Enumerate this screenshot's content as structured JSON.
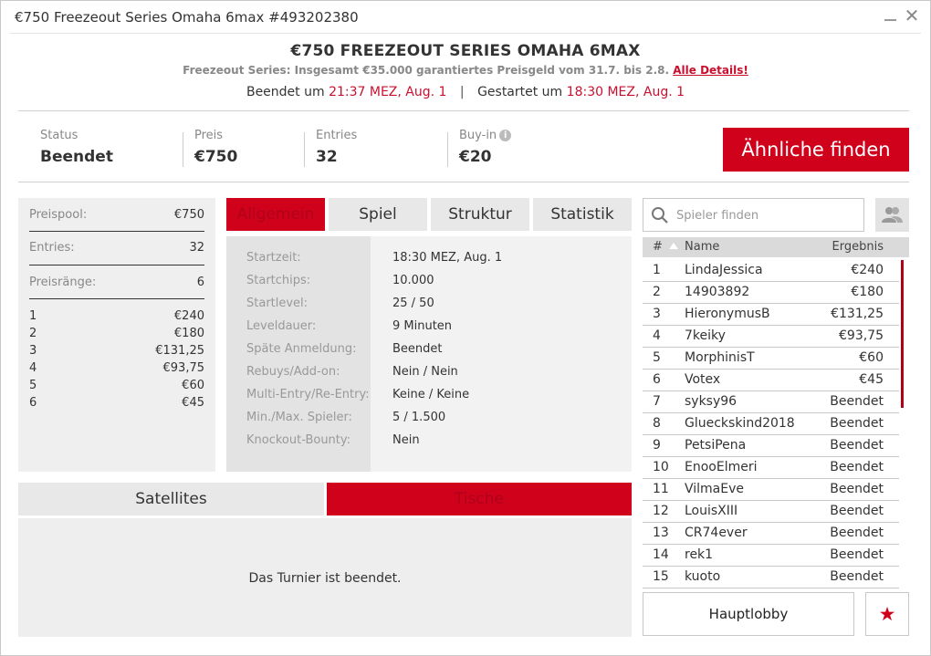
{
  "window": {
    "title": "€750 Freezeout Series Omaha 6max #493202380",
    "minimize_icon": "minimize-icon",
    "close_icon": "close-icon",
    "close_glyph": "✕"
  },
  "header": {
    "title": "€750 FREEZEOUT SERIES OMAHA 6MAX",
    "subtitle": "Freezeout Series: Insgesamt €35.000 garantiertes Preisgeld vom 31.7. bis 2.8.",
    "details_link": "Alle Details!",
    "ended_label": "Beendet um",
    "ended_time": "21:37 MEZ, Aug. 1",
    "separator": "|",
    "started_label": "Gestartet um",
    "started_time": "18:30 MEZ, Aug. 1"
  },
  "stats": [
    {
      "label": "Status",
      "value": "Beendet"
    },
    {
      "label": "Preis",
      "value": "€750"
    },
    {
      "label": "Entries",
      "value": "32"
    },
    {
      "label": "Buy-in",
      "value": "€20"
    }
  ],
  "buyin_info_icon": "info-icon",
  "buyin_info_glyph": "i",
  "similar_button": "Ähnliche finden",
  "prize_panel": {
    "prizepool_label": "Preispool:",
    "prizepool_value": "€750",
    "entries_label": "Entries:",
    "entries_value": "32",
    "ranks_label": "Preisränge:",
    "ranks_value": "6",
    "payouts": [
      {
        "rank": "1",
        "amount": "€240"
      },
      {
        "rank": "2",
        "amount": "€180"
      },
      {
        "rank": "3",
        "amount": "€131,25"
      },
      {
        "rank": "4",
        "amount": "€93,75"
      },
      {
        "rank": "5",
        "amount": "€60"
      },
      {
        "rank": "6",
        "amount": "€45"
      }
    ]
  },
  "tabs": [
    "Allgemein",
    "Spiel",
    "Struktur",
    "Statistik"
  ],
  "active_tab": "Allgemein",
  "info": [
    {
      "key": "Startzeit:",
      "value": "18:30 MEZ, Aug. 1"
    },
    {
      "key": "Startchips:",
      "value": "10.000"
    },
    {
      "key": "Startlevel:",
      "value": "25 / 50"
    },
    {
      "key": "Leveldauer:",
      "value": "9 Minuten"
    },
    {
      "key": "Späte Anmeldung:",
      "value": "Beendet"
    },
    {
      "key": "Rebuys/Add-on:",
      "value": "Nein / Nein"
    },
    {
      "key": "Multi-Entry/Re-Entry:",
      "value": "Keine / Keine"
    },
    {
      "key": "Min./Max. Spieler:",
      "value": "5 / 1.500"
    },
    {
      "key": "Knockout-Bounty:",
      "value": "Nein"
    }
  ],
  "bottom_tabs": [
    "Satellites",
    "Tische"
  ],
  "bottom_message": "Das Turnier ist beendet.",
  "search": {
    "placeholder": "Spieler finden",
    "value": "",
    "icon": "search-icon"
  },
  "players_icon": "players-icon",
  "table": {
    "headers": [
      "#",
      "Name",
      "Ergebnis"
    ],
    "rows": [
      {
        "rank": "1",
        "name": "LindaJessica",
        "result": "€240"
      },
      {
        "rank": "2",
        "name": "14903892",
        "result": "€180"
      },
      {
        "rank": "3",
        "name": "HieronymusB",
        "result": "€131,25"
      },
      {
        "rank": "4",
        "name": "7keiky",
        "result": "€93,75"
      },
      {
        "rank": "5",
        "name": "MorphinisT",
        "result": "€60"
      },
      {
        "rank": "6",
        "name": "Votex",
        "result": "€45"
      },
      {
        "rank": "7",
        "name": "syksy96",
        "result": "Beendet"
      },
      {
        "rank": "8",
        "name": "Glueckskind2018",
        "result": "Beendet"
      },
      {
        "rank": "9",
        "name": "PetsiPena",
        "result": "Beendet"
      },
      {
        "rank": "10",
        "name": "EnooElmeri",
        "result": "Beendet"
      },
      {
        "rank": "11",
        "name": "VilmaEve",
        "result": "Beendet"
      },
      {
        "rank": "12",
        "name": "LouisXIII",
        "result": "Beendet"
      },
      {
        "rank": "13",
        "name": "CR74ever",
        "result": "Beendet"
      },
      {
        "rank": "14",
        "name": "rek1",
        "result": "Beendet"
      },
      {
        "rank": "15",
        "name": "kuoto",
        "result": "Beendet"
      }
    ]
  },
  "lobby_button": "Hauptlobby",
  "favorite_icon": "star-icon",
  "favorite_glyph": "★",
  "colors": {
    "accent": "#d0021b",
    "panel": "#efefef"
  }
}
